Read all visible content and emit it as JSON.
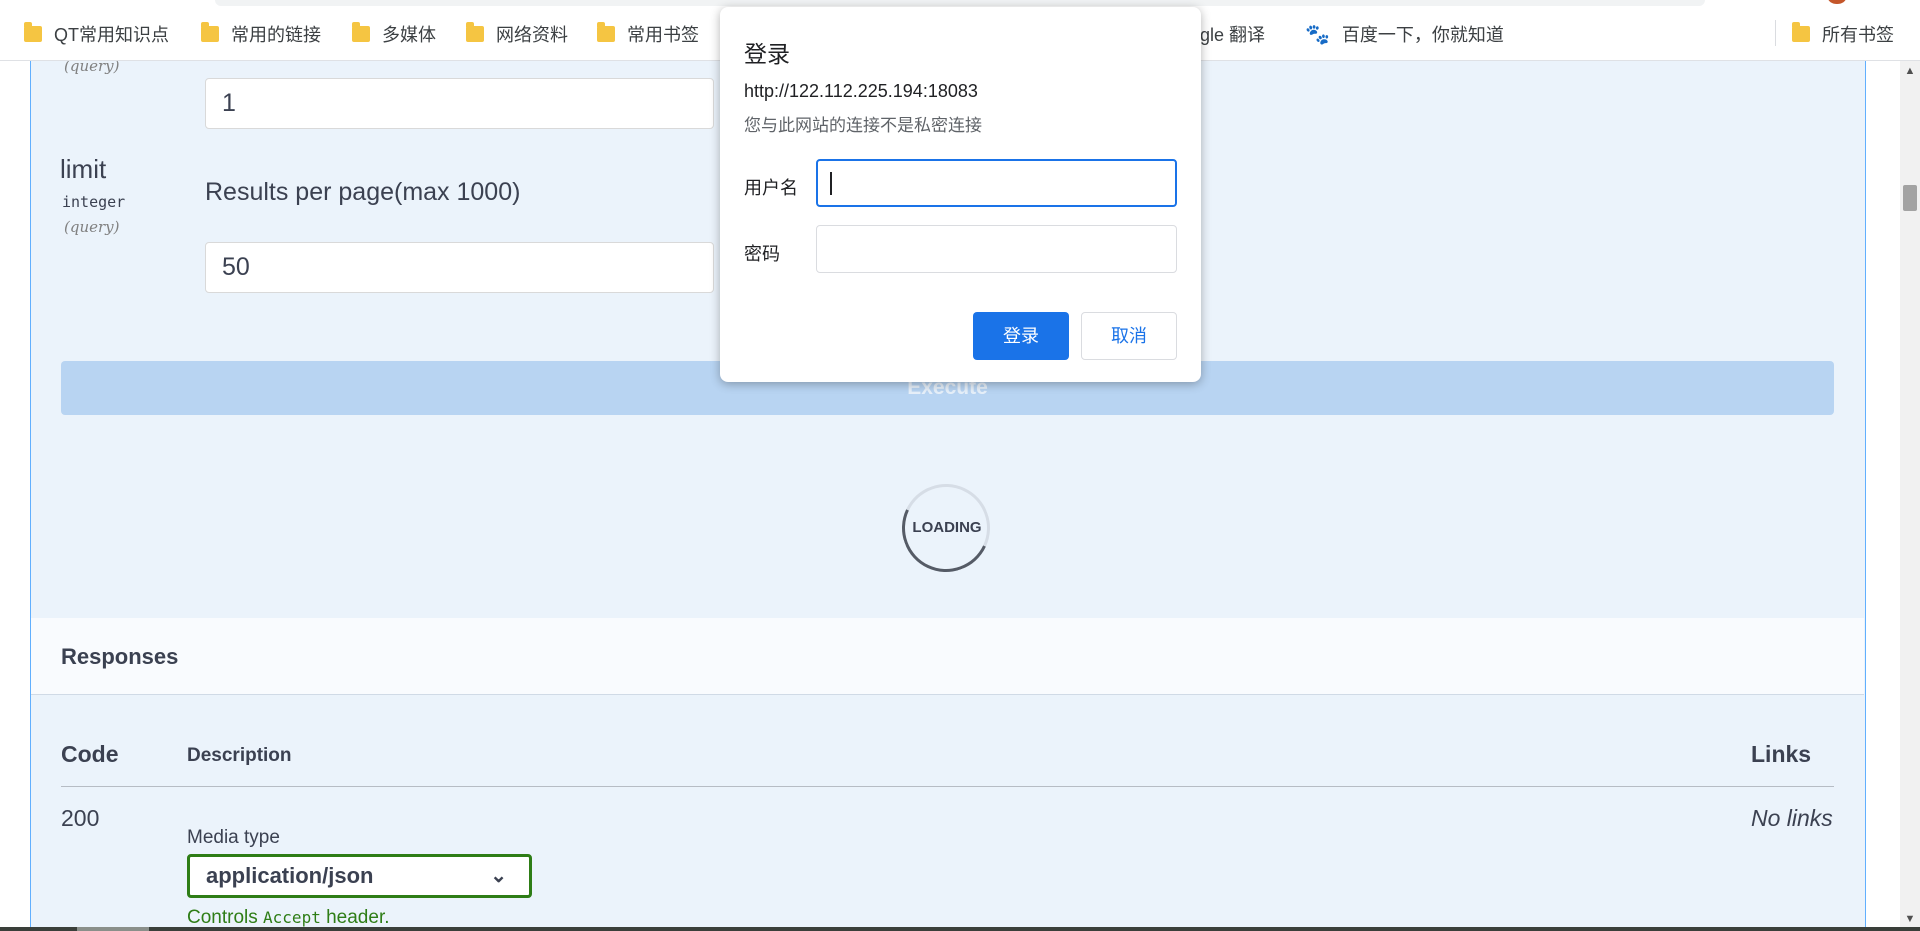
{
  "bookmarks": {
    "items": [
      {
        "label": "QT常用知识点",
        "icon": "folder-icon"
      },
      {
        "label": "常用的链接",
        "icon": "folder-icon"
      },
      {
        "label": "多媒体",
        "icon": "folder-icon"
      },
      {
        "label": "网络资料",
        "icon": "folder-icon"
      },
      {
        "label": "常用书签",
        "icon": "folder-icon"
      },
      {
        "label": "ogle 翻译",
        "icon": ""
      },
      {
        "label": "百度一下，你就知道",
        "icon": "baidu-paw-icon"
      }
    ],
    "all_bookmarks": "所有书签"
  },
  "parameters": [
    {
      "in": "(query)",
      "value": "1"
    },
    {
      "name": "limit",
      "type": "integer",
      "in": "(query)",
      "description": "Results per page(max 1000)",
      "value": "50"
    }
  ],
  "execute_label": "Execute",
  "loading_label": "LOADING",
  "responses": {
    "title": "Responses",
    "headers": {
      "code": "Code",
      "description": "Description",
      "links": "Links"
    },
    "rows": [
      {
        "code": "200",
        "links": "No links",
        "media_type_label": "Media type",
        "media_type_value": "application/json",
        "controls_prefix": "Controls",
        "controls_code": "Accept",
        "controls_suffix": "header."
      }
    ]
  },
  "auth_dialog": {
    "title": "登录",
    "url": "http://122.112.225.194:18083",
    "warning": "您与此网站的连接不是私密连接",
    "username_label": "用户名",
    "username_value": "",
    "password_label": "密码",
    "password_value": "",
    "login_button": "登录",
    "cancel_button": "取消"
  },
  "colors": {
    "accent_blue": "#1a73e8",
    "swagger_get_blue": "#61affe",
    "media_type_green": "#2e7d16"
  }
}
